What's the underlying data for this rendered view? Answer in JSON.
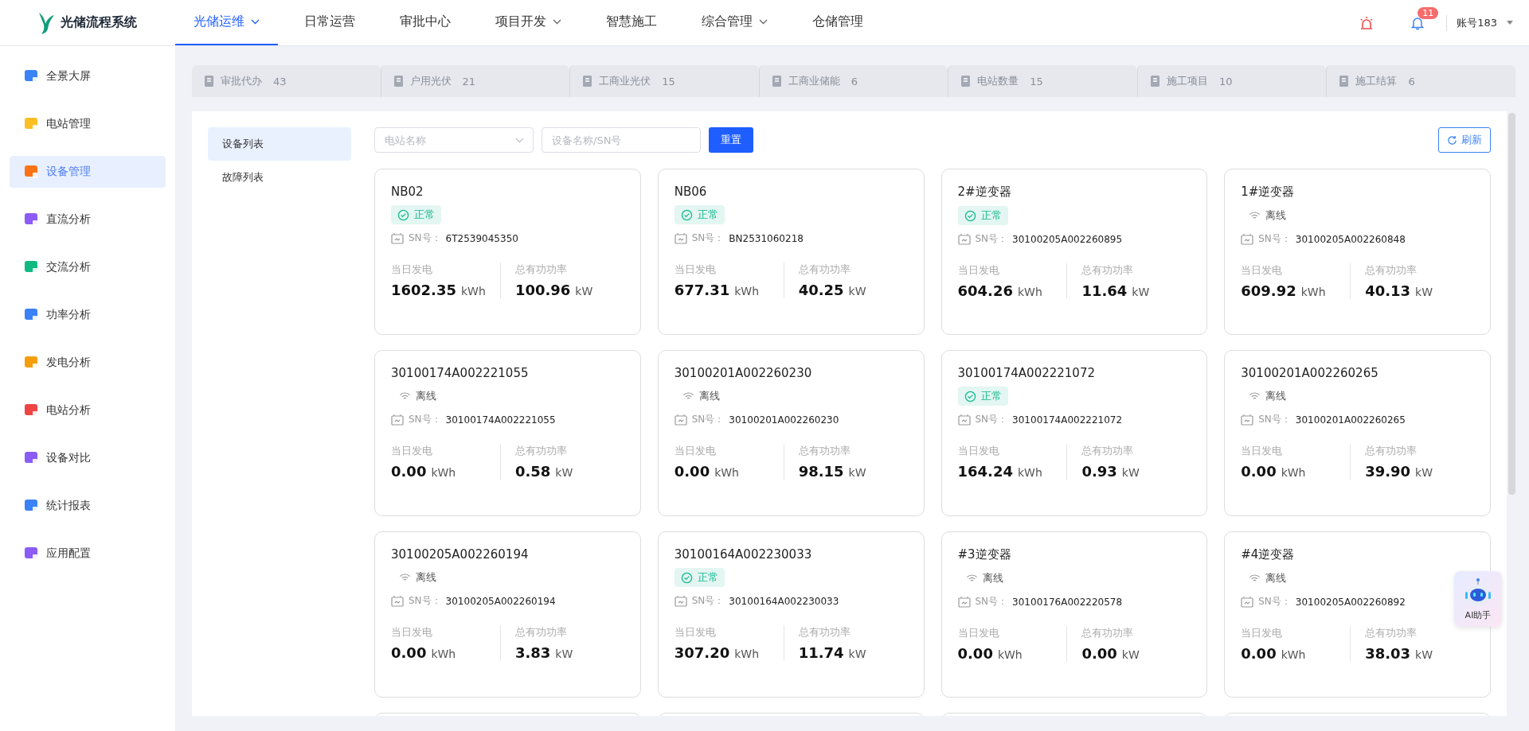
{
  "app": {
    "title": "光储流程系统"
  },
  "top_nav": [
    {
      "label": "光储运维",
      "selected": true,
      "has_menu": true
    },
    {
      "label": "日常运营",
      "selected": false,
      "has_menu": false
    },
    {
      "label": "审批中心",
      "selected": false,
      "has_menu": false
    },
    {
      "label": "项目开发",
      "selected": false,
      "has_menu": true
    },
    {
      "label": "智慧施工",
      "selected": false,
      "has_menu": false
    },
    {
      "label": "综合管理",
      "selected": false,
      "has_menu": true
    },
    {
      "label": "仓储管理",
      "selected": false,
      "has_menu": false
    }
  ],
  "header": {
    "notification_count": "11",
    "account": "账号183"
  },
  "sidebar": {
    "items": [
      {
        "label": "全景大屏",
        "selected": false,
        "color": "#3b82f6"
      },
      {
        "label": "电站管理",
        "selected": false,
        "color": "#fbbf24"
      },
      {
        "label": "设备管理",
        "selected": true,
        "color": "#f97316"
      },
      {
        "label": "直流分析",
        "selected": false,
        "color": "#8b5cf6"
      },
      {
        "label": "交流分析",
        "selected": false,
        "color": "#10b981"
      },
      {
        "label": "功率分析",
        "selected": false,
        "color": "#3b82f6"
      },
      {
        "label": "发电分析",
        "selected": false,
        "color": "#f59e0b"
      },
      {
        "label": "电站分析",
        "selected": false,
        "color": "#ef4444"
      },
      {
        "label": "设备对比",
        "selected": false,
        "color": "#8b5cf6"
      },
      {
        "label": "统计报表",
        "selected": false,
        "color": "#3b82f6"
      },
      {
        "label": "应用配置",
        "selected": false,
        "color": "#8b5cf6"
      }
    ]
  },
  "summary_tabs": [
    {
      "label": "审批代办",
      "count": "43"
    },
    {
      "label": "户用光伏",
      "count": "21"
    },
    {
      "label": "工商业光伏",
      "count": "15"
    },
    {
      "label": "工商业储能",
      "count": "6"
    },
    {
      "label": "电站数量",
      "count": "15"
    },
    {
      "label": "施工项目",
      "count": "10"
    },
    {
      "label": "施工结算",
      "count": "6"
    }
  ],
  "sub_menu": [
    {
      "label": "设备列表",
      "selected": true
    },
    {
      "label": "故障列表",
      "selected": false
    }
  ],
  "filters": {
    "station_placeholder": "电站名称",
    "device_placeholder": "设备名称/SN号",
    "reset": "重置",
    "refresh": "刷新"
  },
  "devices": [
    {
      "name": "NB02",
      "kind": "normal",
      "status": "正常",
      "sn_label": "SN号：",
      "sn": "6T2539045350",
      "energy_label": "当日发电",
      "energy": "1602.35",
      "energy_unit": "kWh",
      "power_label": "总有功功率",
      "power": "100.96",
      "power_unit": "kW"
    },
    {
      "name": "NB06",
      "kind": "normal",
      "status": "正常",
      "sn_label": "SN号：",
      "sn": "BN2531060218",
      "energy_label": "当日发电",
      "energy": "677.31",
      "energy_unit": "kWh",
      "power_label": "总有功功率",
      "power": "40.25",
      "power_unit": "kW"
    },
    {
      "name": "2#逆变器",
      "kind": "normal",
      "status": "正常",
      "sn_label": "SN号：",
      "sn": "30100205A002260895",
      "energy_label": "当日发电",
      "energy": "604.26",
      "energy_unit": "kWh",
      "power_label": "总有功功率",
      "power": "11.64",
      "power_unit": "kW"
    },
    {
      "name": "1#逆变器",
      "kind": "offline",
      "status": "离线",
      "sn_label": "SN号：",
      "sn": "30100205A002260848",
      "energy_label": "当日发电",
      "energy": "609.92",
      "energy_unit": "kWh",
      "power_label": "总有功功率",
      "power": "40.13",
      "power_unit": "kW"
    },
    {
      "name": "30100174A002221055",
      "kind": "offline",
      "status": "离线",
      "sn_label": "SN号：",
      "sn": "30100174A002221055",
      "energy_label": "当日发电",
      "energy": "0.00",
      "energy_unit": "kWh",
      "power_label": "总有功功率",
      "power": "0.58",
      "power_unit": "kW"
    },
    {
      "name": "30100201A002260230",
      "kind": "offline",
      "status": "离线",
      "sn_label": "SN号：",
      "sn": "30100201A002260230",
      "energy_label": "当日发电",
      "energy": "0.00",
      "energy_unit": "kWh",
      "power_label": "总有功功率",
      "power": "98.15",
      "power_unit": "kW"
    },
    {
      "name": "30100174A002221072",
      "kind": "normal",
      "status": "正常",
      "sn_label": "SN号：",
      "sn": "30100174A002221072",
      "energy_label": "当日发电",
      "energy": "164.24",
      "energy_unit": "kWh",
      "power_label": "总有功功率",
      "power": "0.93",
      "power_unit": "kW"
    },
    {
      "name": "30100201A002260265",
      "kind": "offline",
      "status": "离线",
      "sn_label": "SN号：",
      "sn": "30100201A002260265",
      "energy_label": "当日发电",
      "energy": "0.00",
      "energy_unit": "kWh",
      "power_label": "总有功功率",
      "power": "39.90",
      "power_unit": "kW"
    },
    {
      "name": "30100205A002260194",
      "kind": "offline",
      "status": "离线",
      "sn_label": "SN号：",
      "sn": "30100205A002260194",
      "energy_label": "当日发电",
      "energy": "0.00",
      "energy_unit": "kWh",
      "power_label": "总有功功率",
      "power": "3.83",
      "power_unit": "kW"
    },
    {
      "name": "30100164A002230033",
      "kind": "normal",
      "status": "正常",
      "sn_label": "SN号：",
      "sn": "30100164A002230033",
      "energy_label": "当日发电",
      "energy": "307.20",
      "energy_unit": "kWh",
      "power_label": "总有功功率",
      "power": "11.74",
      "power_unit": "kW"
    },
    {
      "name": "#3逆变器",
      "kind": "offline",
      "status": "离线",
      "sn_label": "SN号：",
      "sn": "30100176A002220578",
      "energy_label": "当日发电",
      "energy": "0.00",
      "energy_unit": "kWh",
      "power_label": "总有功功率",
      "power": "0.00",
      "power_unit": "kW"
    },
    {
      "name": "#4逆变器",
      "kind": "offline",
      "status": "离线",
      "sn_label": "SN号：",
      "sn": "30100205A002260892",
      "energy_label": "当日发电",
      "energy": "0.00",
      "energy_unit": "kWh",
      "power_label": "总有功功率",
      "power": "38.03",
      "power_unit": "kW"
    }
  ],
  "assistant": {
    "label": "AI助手"
  }
}
